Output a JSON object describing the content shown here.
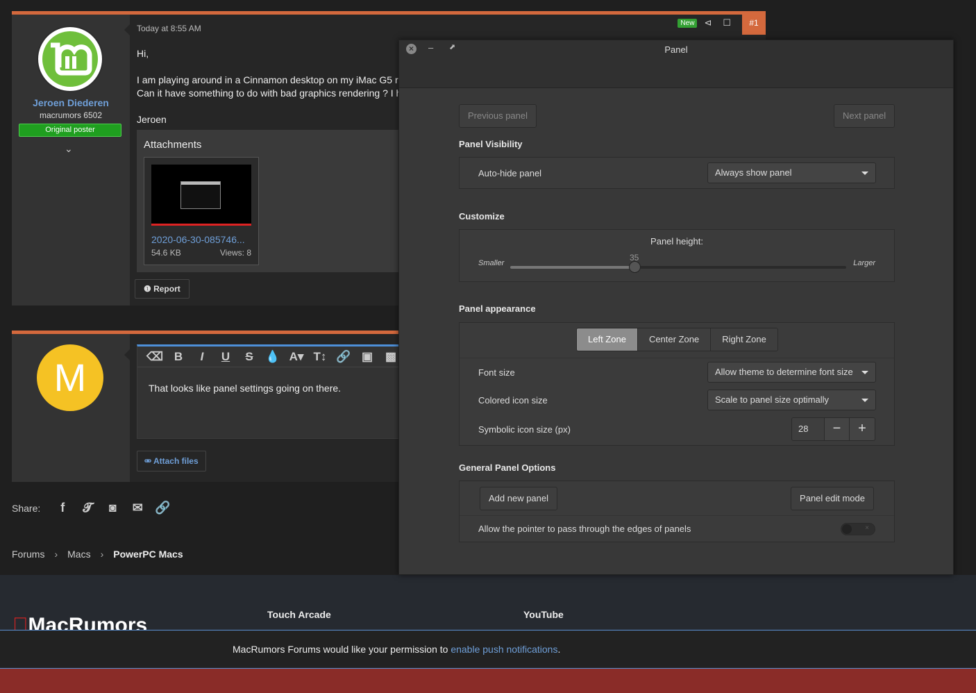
{
  "post1": {
    "username": "Jeroen Diederen",
    "user_title": "macrumors 6502",
    "badge": "Original poster",
    "time": "Today at 8:55 AM",
    "new_label": "New",
    "post_number": "#1",
    "greeting": "Hi,",
    "line1": "I am playing around in a Cinnamon desktop on my iMac G5 r",
    "line2": "Can it have something to do with bad graphics rendering ? I h",
    "signoff": "Jeroen",
    "attachments_title": "Attachments",
    "attachment": {
      "name": "2020-06-30-085746...",
      "size": "54.6 KB",
      "views": "Views: 8"
    },
    "report_label": "Report"
  },
  "post2": {
    "avatar_letter": "M",
    "editor_text": "That looks like panel settings going on there.",
    "attach_files_label": "Attach files"
  },
  "share_label": "Share:",
  "breadcrumb": [
    "Forums",
    "Macs",
    "PowerPC Macs"
  ],
  "footer": {
    "logo": "MacRumors",
    "col1": "Touch Arcade",
    "col2": "YouTube"
  },
  "notice": {
    "text": "MacRumors Forums would like your permission to ",
    "link": "enable push notifications",
    "end": "."
  },
  "dialog": {
    "title": "Panel",
    "previous_panel": "Previous panel",
    "next_panel": "Next panel",
    "visibility_heading": "Panel Visibility",
    "autohide_label": "Auto-hide panel",
    "autohide_value": "Always show panel",
    "customize_heading": "Customize",
    "height_label": "Panel height:",
    "smaller": "Smaller",
    "larger": "Larger",
    "height_value": "35",
    "height_fraction": 0.37,
    "appearance_heading": "Panel appearance",
    "zones": [
      "Left Zone",
      "Center Zone",
      "Right Zone"
    ],
    "font_size_label": "Font size",
    "font_size_value": "Allow theme to determine font size",
    "colored_icon_label": "Colored icon size",
    "colored_icon_value": "Scale to panel size optimally",
    "symbolic_icon_label": "Symbolic icon size (px)",
    "symbolic_icon_value": "28",
    "general_heading": "General Panel Options",
    "add_panel": "Add new panel",
    "edit_mode": "Panel edit mode",
    "pointer_label": "Allow the pointer to pass through the edges of panels",
    "pointer_toggle": false
  },
  "colors": {
    "accent": "#d4693d",
    "link": "#6f9fd8",
    "badge_green": "#1f9f1f",
    "avatar_yellow": "#f5c224"
  }
}
